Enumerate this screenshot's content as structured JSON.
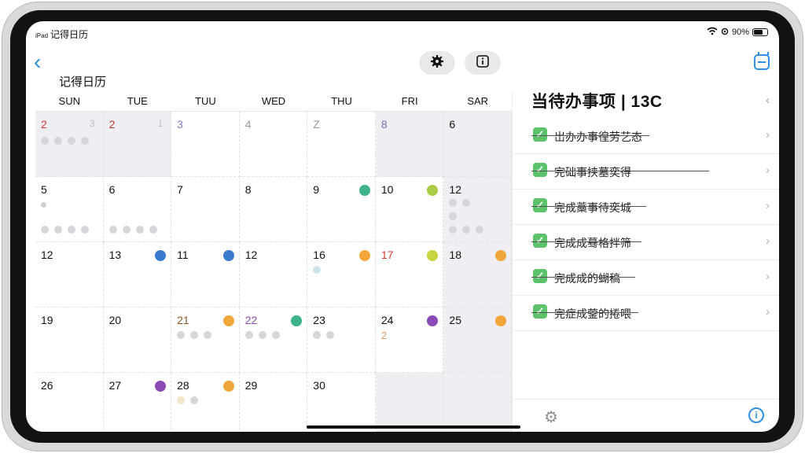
{
  "status": {
    "device": "iPad",
    "app": "记得日历",
    "battery": "90%"
  },
  "header": {
    "title": "记得日历",
    "back": "‹",
    "settings_icon": "gear-icon",
    "info_icon": "info-icon",
    "calendar_icon": "calendar-icon"
  },
  "weekdays": [
    "SUN",
    "TUE",
    "TUU",
    "WED",
    "THU",
    "FRI",
    "SAR"
  ],
  "days": {
    "r0": [
      "2",
      "2",
      "3",
      "4",
      "Z",
      "8",
      "6"
    ],
    "r0_ghost": [
      "3",
      "1"
    ],
    "r1": [
      "5",
      "6",
      "7",
      "8",
      "9",
      "10",
      "12"
    ],
    "r2": [
      "12",
      "13",
      "11",
      "12",
      "16",
      "17",
      "18"
    ],
    "r3": [
      "19",
      "20",
      "21",
      "22",
      "23",
      "24",
      "25"
    ],
    "r3_sub": "2",
    "r4": [
      "26",
      "27",
      "28",
      "29",
      "30"
    ]
  },
  "colors": {
    "green": "#3db38a",
    "lime": "#a8cd45",
    "blue": "#3a7bd0",
    "orange": "#f0a63a",
    "purple": "#8a4bb5",
    "red": "#d9392f",
    "check": "#5cc36a",
    "accent": "#2f8fe0"
  },
  "todo": {
    "title": "当待办事项 | 13C",
    "collapse": "‹",
    "items": [
      "岀办办事徨劳艺态",
      "完础事挟墓奕得",
      "完成藁事待奕城",
      "完成成蓦格拌筛",
      "完成成的蝴稿",
      "完症成蓥的捲喂"
    ]
  },
  "bottom": {
    "left_icon": "gear-icon",
    "right_icon": "info-icon"
  }
}
